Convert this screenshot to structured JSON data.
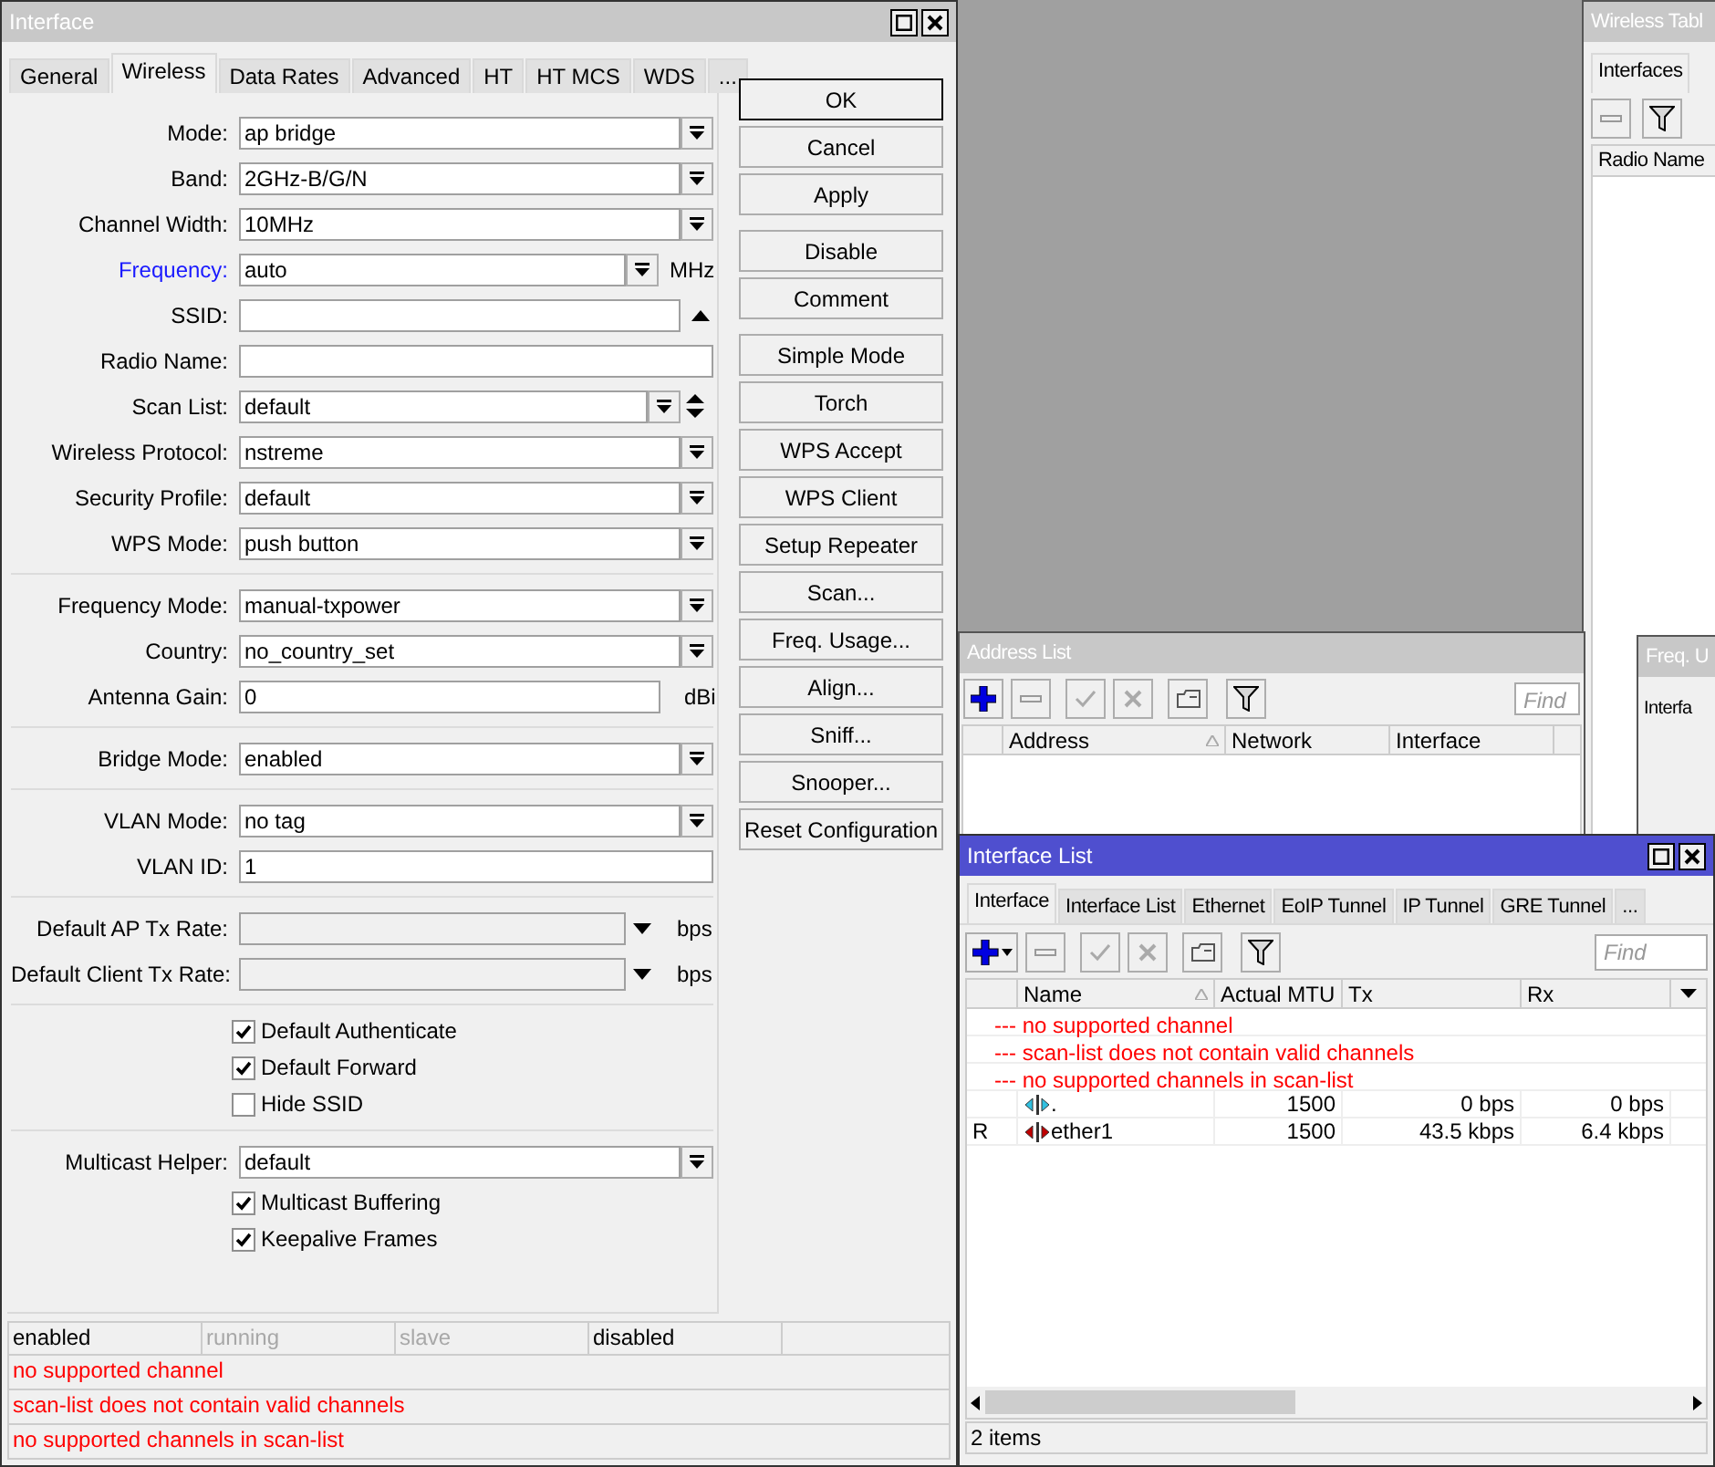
{
  "interface_window": {
    "title": "Interface",
    "active": false,
    "tabs": [
      {
        "label": "General",
        "selected": false
      },
      {
        "label": "Wireless",
        "selected": true
      },
      {
        "label": "Data Rates",
        "selected": false
      },
      {
        "label": "Advanced",
        "selected": false
      },
      {
        "label": "HT",
        "selected": false
      },
      {
        "label": "HT MCS",
        "selected": false
      },
      {
        "label": "WDS",
        "selected": false
      },
      {
        "label": "...",
        "selected": false
      }
    ],
    "sections": [
      {
        "fields": [
          {
            "kind": "select",
            "label": "Mode:",
            "value": "ap bridge"
          },
          {
            "kind": "select",
            "label": "Band:",
            "value": "2GHz-B/G/N"
          },
          {
            "kind": "select",
            "label": "Channel Width:",
            "value": "10MHz"
          },
          {
            "kind": "select_unit",
            "label": "Frequency:",
            "value": "auto",
            "unit": "MHz",
            "linked": true
          },
          {
            "kind": "text_toggle",
            "label": "SSID:"
          },
          {
            "kind": "text",
            "label": "Radio Name:"
          },
          {
            "kind": "select_updown",
            "label": "Scan List:",
            "value": "default"
          },
          {
            "kind": "select",
            "label": "Wireless Protocol:",
            "value": "nstreme"
          },
          {
            "kind": "select",
            "label": "Security Profile:",
            "value": "default"
          },
          {
            "kind": "select",
            "label": "WPS Mode:",
            "value": "push button"
          }
        ]
      },
      {
        "fields": [
          {
            "kind": "select",
            "label": "Frequency Mode:",
            "value": "manual-txpower"
          },
          {
            "kind": "select",
            "label": "Country:",
            "value": "no_country_set"
          },
          {
            "kind": "text_unit",
            "label": "Antenna Gain:",
            "value": "0",
            "unit": "dBi"
          }
        ]
      },
      {
        "fields": [
          {
            "kind": "select",
            "label": "Bridge Mode:",
            "value": "enabled"
          }
        ]
      },
      {
        "fields": [
          {
            "kind": "select",
            "label": "VLAN Mode:",
            "value": "no tag"
          },
          {
            "kind": "text",
            "label": "VLAN ID:",
            "value": "1"
          }
        ]
      },
      {
        "fields": [
          {
            "kind": "rate",
            "label": "Default AP Tx Rate:",
            "unit": "bps"
          },
          {
            "kind": "rate",
            "label": "Default Client Tx Rate:",
            "unit": "bps"
          }
        ]
      },
      {
        "fields": [
          {
            "kind": "checkbox",
            "label": "Default Authenticate",
            "checked": true
          },
          {
            "kind": "checkbox",
            "label": "Default Forward",
            "checked": true
          },
          {
            "kind": "checkbox",
            "label": "Hide SSID",
            "checked": false
          }
        ]
      },
      {
        "fields": [
          {
            "kind": "select",
            "label": "Multicast Helper:",
            "value": "default"
          },
          {
            "kind": "checkbox",
            "label": "Multicast Buffering",
            "checked": true
          },
          {
            "kind": "checkbox",
            "label": "Keepalive Frames",
            "checked": true
          }
        ]
      }
    ],
    "button_groups": [
      [
        {
          "label": "OK",
          "default": true
        },
        {
          "label": "Cancel",
          "default": false
        },
        {
          "label": "Apply",
          "default": false
        }
      ],
      [
        {
          "label": "Disable",
          "default": false
        },
        {
          "label": "Comment",
          "default": false
        }
      ],
      [
        {
          "label": "Simple Mode",
          "default": false
        },
        {
          "label": "Torch",
          "default": false
        },
        {
          "label": "WPS Accept",
          "default": false
        },
        {
          "label": "WPS Client",
          "default": false
        },
        {
          "label": "Setup Repeater",
          "default": false
        },
        {
          "label": "Scan...",
          "default": false
        },
        {
          "label": "Freq. Usage...",
          "default": false
        },
        {
          "label": "Align...",
          "default": false
        },
        {
          "label": "Sniff...",
          "default": false
        },
        {
          "label": "Snooper...",
          "default": false
        },
        {
          "label": "Reset Configuration",
          "default": false
        }
      ]
    ],
    "status_cells": [
      {
        "text": "enabled",
        "disabled": false
      },
      {
        "text": "running",
        "disabled": true
      },
      {
        "text": "slave",
        "disabled": true
      },
      {
        "text": "disabled",
        "disabled": false
      }
    ],
    "messages": [
      "no supported channel",
      "scan-list does not contain valid channels",
      "no supported channels in scan-list"
    ]
  },
  "wireless_table_window": {
    "title": "Wireless Tabl",
    "active": false,
    "tabs": [
      {
        "label": "Interfaces",
        "selected": true
      }
    ],
    "columns": [
      "Radio Name"
    ]
  },
  "address_list_window": {
    "title": "Address List",
    "active": false,
    "find_placeholder": "Find",
    "columns": [
      {
        "label": "Address",
        "sorted": true
      },
      {
        "label": "Network",
        "sorted": false
      },
      {
        "label": "Interface",
        "sorted": false
      }
    ]
  },
  "freq_usage_window": {
    "title": "Freq. U",
    "active": false,
    "label": "Interfa"
  },
  "interface_list_window": {
    "title": "Interface List",
    "active": true,
    "tabs": [
      {
        "label": "Interface",
        "selected": true
      },
      {
        "label": "Interface List",
        "selected": false
      },
      {
        "label": "Ethernet",
        "selected": false
      },
      {
        "label": "EoIP Tunnel",
        "selected": false
      },
      {
        "label": "IP Tunnel",
        "selected": false
      },
      {
        "label": "GRE Tunnel",
        "selected": false
      },
      {
        "label": "...",
        "selected": false
      }
    ],
    "find_placeholder": "Find",
    "columns": [
      {
        "label": "Name",
        "sorted": true
      },
      {
        "label": "Actual MTU",
        "sorted": false
      },
      {
        "label": "Tx",
        "sorted": false
      },
      {
        "label": "Rx",
        "sorted": false
      }
    ],
    "rows": [
      {
        "kind": "comment",
        "text": "--- no supported channel"
      },
      {
        "kind": "comment",
        "text": "--- scan-list does not contain valid channels"
      },
      {
        "kind": "comment",
        "text": "--- no supported channels in scan-list"
      },
      {
        "kind": "wlan",
        "name": ".",
        "mtu": "1500",
        "tx": "0 bps",
        "rx": "0 bps"
      },
      {
        "kind": "ether",
        "flag": "R",
        "name": "ether1",
        "mtu": "1500",
        "tx": "43.5 kbps",
        "rx": "6.4 kbps"
      }
    ],
    "status": "2 items"
  }
}
